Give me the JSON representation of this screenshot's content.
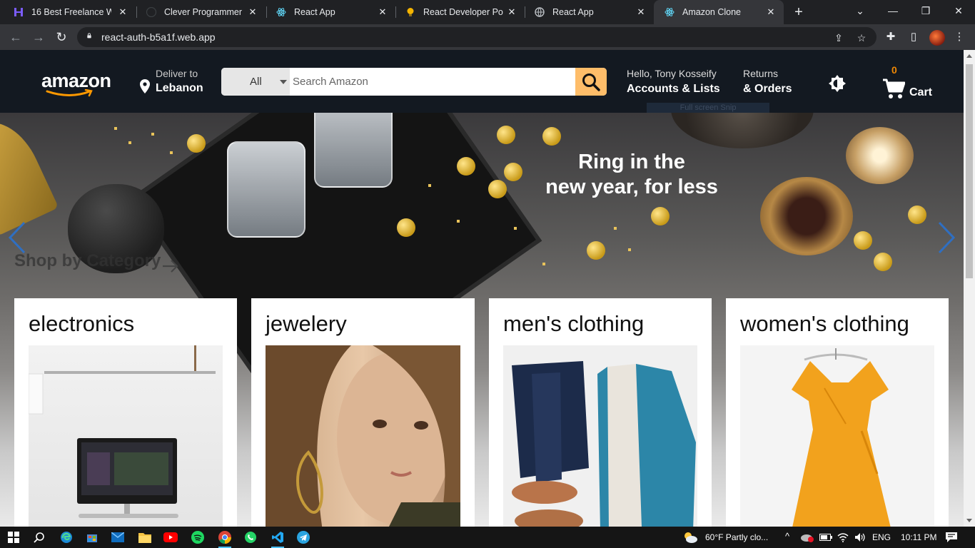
{
  "browser": {
    "tabs": [
      {
        "title": "16 Best Freelance Web",
        "favicon": "freelance-icon",
        "active": false
      },
      {
        "title": "Clever Programmer",
        "favicon": "github-icon",
        "active": false
      },
      {
        "title": "React App",
        "favicon": "react-icon",
        "active": false
      },
      {
        "title": "React Developer Portfo",
        "favicon": "bulb-icon",
        "active": false
      },
      {
        "title": "React App",
        "favicon": "globe-icon",
        "active": false
      },
      {
        "title": "Amazon Clone",
        "favicon": "react-icon",
        "active": true
      }
    ],
    "url": "react-auth-b5a1f.web.app"
  },
  "header": {
    "logo_text": "amazon",
    "deliver_label": "Deliver to",
    "deliver_location": "Lebanon",
    "search_category": "All",
    "search_placeholder": "Search Amazon",
    "greeting": "Hello, Tony Kosseify",
    "accounts_label": "Accounts & Lists",
    "returns_label": "Returns",
    "orders_label": "& Orders",
    "cart_count": "0",
    "cart_label": "Cart",
    "tooltip_ghost": "Full screen Snip"
  },
  "hero": {
    "headline_line1": "Ring in the",
    "headline_line2": "new year, for less",
    "shop_by_category": "Shop by Category"
  },
  "categories": [
    {
      "title": "electronics"
    },
    {
      "title": "jewelery"
    },
    {
      "title": "men's clothing"
    },
    {
      "title": "women's clothing"
    }
  ],
  "taskbar": {
    "weather": "60°F  Partly clo...",
    "language": "ENG",
    "time": "10:11 PM"
  },
  "colors": {
    "header_bg": "#131921",
    "search_button": "#febd69",
    "cart_count": "#f08804",
    "browser_frame": "#202124"
  }
}
